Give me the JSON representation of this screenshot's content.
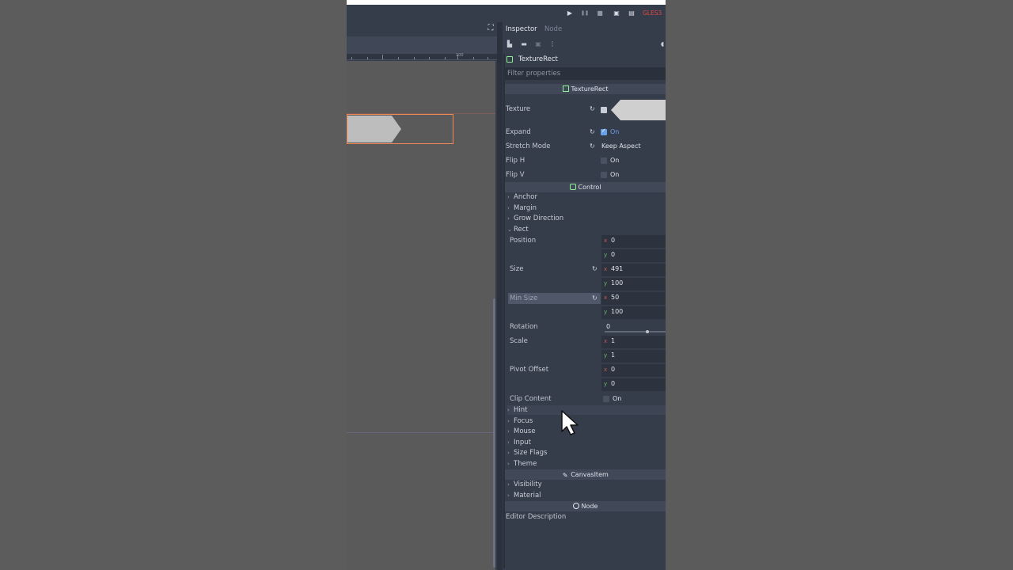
{
  "topbar": {
    "play_icon": "▶",
    "pause_icon": "❚❚",
    "stop_icon": "■",
    "scene_icon": "▣",
    "custom_icon": "▤",
    "renderer": "GLES3"
  },
  "viewport": {
    "fullscreen_icon": "⛶",
    "ruler_label": "100"
  },
  "inspector": {
    "tabs": [
      {
        "label": "Inspector"
      },
      {
        "label": "Node"
      }
    ],
    "node_name": "TextureRect",
    "filter_placeholder": "Filter properties",
    "sections": {
      "texture_rect": "TextureRect",
      "control": "Control",
      "canvas_item": "CanvasItem",
      "node": "Node"
    },
    "props": {
      "texture": "Texture",
      "expand": "Expand",
      "expand_value": "On",
      "stretch_mode": "Stretch Mode",
      "stretch_mode_value": "Keep Aspect",
      "flip_h": "Flip H",
      "flip_h_value": "On",
      "flip_v": "Flip V",
      "flip_v_value": "On",
      "position": "Position",
      "size": "Size",
      "min_size": "Min Size",
      "rotation": "Rotation",
      "scale": "Scale",
      "pivot_offset": "Pivot Offset",
      "clip_content": "Clip Content",
      "clip_content_value": "On",
      "editor_description": "Editor Description"
    },
    "groups": {
      "anchor": "Anchor",
      "margin": "Margin",
      "grow_direction": "Grow Direction",
      "rect": "Rect",
      "hint": "Hint",
      "focus": "Focus",
      "mouse": "Mouse",
      "input": "Input",
      "size_flags": "Size Flags",
      "theme": "Theme",
      "visibility": "Visibility",
      "material": "Material"
    },
    "values": {
      "position": {
        "x": "0",
        "y": "0"
      },
      "size": {
        "x": "491",
        "y": "100"
      },
      "min_size": {
        "x": "50",
        "y": "100"
      },
      "rotation": "0",
      "scale": {
        "x": "1",
        "y": "1"
      },
      "pivot_offset": {
        "x": "0",
        "y": "0"
      }
    },
    "axis_labels": {
      "x": "x",
      "y": "y"
    }
  },
  "colors": {
    "accent": "#6aa0ea",
    "selection": "#f08a52",
    "renderer": "#e0473c"
  }
}
